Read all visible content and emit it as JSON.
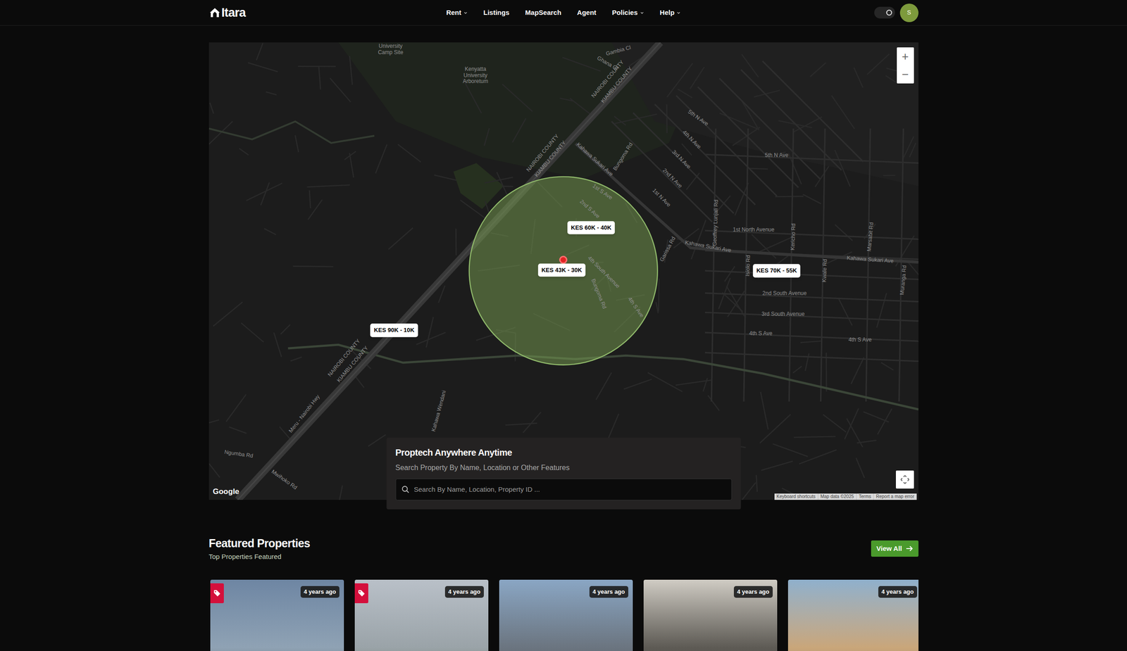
{
  "nav": {
    "logo": "Itara",
    "items": [
      {
        "label": "Rent",
        "kind": "dropdown"
      },
      {
        "label": "Listings",
        "kind": "link"
      },
      {
        "label": "MapSearch",
        "kind": "link"
      },
      {
        "label": "Agent",
        "kind": "link"
      },
      {
        "label": "Policies",
        "kind": "dropdown"
      },
      {
        "label": "Help",
        "kind": "dropdown"
      }
    ],
    "avatar": "S"
  },
  "map": {
    "labels": [
      "University",
      "Camp Site",
      "Kenyatta",
      "University",
      "Arboretum",
      "Gambia Cl",
      "Ghana Cl",
      "NAIROBI COUNTY",
      "KIAMBU COUNTY",
      "NAIROBI COUNTY",
      "KIAMBU COUNTY",
      "NAIROBI COUNTY",
      "KIAMBU COUNTY",
      "Kahawa Sukari Ave",
      "Bungoma Rd",
      "5th N Ave",
      "4th N Ave",
      "3rd N Ave",
      "2nd N Ave",
      "1st N Ave",
      "5th N Ave",
      "1st S Ave",
      "2nd S Ave",
      "4th South Avenue",
      "Bungoma Rd",
      "4th S Ave",
      "Garissa Rd",
      "Kahawa Sukari Ave",
      "Geoffrey Lunjali Rd",
      "1st North Avenue",
      "Kericho Rd",
      "Marsabit Rd",
      "Kahawa Sukari Ave",
      "Muranga Rd",
      "Isiolo Rd",
      "Kwale Rd",
      "2nd South Avenue",
      "3rd South Avenue",
      "4th S Ave",
      "4th S Ave",
      "Ngumba Rd",
      "Mwihoko Rd",
      "Meru - Nairobi Hwy",
      "Kahawa Wendani"
    ],
    "price_pins": [
      "KES 60K - 40K",
      "KES 43K - 30K",
      "KES 70K - 55K",
      "KES 90K - 10K"
    ],
    "zoom": [
      "+",
      "−"
    ],
    "google": "Google",
    "attribution": [
      "Keyboard shortcuts",
      "Map data ©2025",
      "Terms",
      "Report a map error"
    ]
  },
  "search": {
    "title": "Proptech Anywhere Anytime",
    "subtitle": "Search Property By Name, Location or Other Features",
    "placeholder": "Search By Name, Location, Property ID ..."
  },
  "featured": {
    "title": "Featured Properties",
    "subtitle": "Top Properties Featured",
    "view_all": "View All",
    "cards": [
      {
        "time": "4 years ago",
        "tagged": true
      },
      {
        "time": "4 years ago",
        "tagged": true
      },
      {
        "time": "4 years ago",
        "tagged": false
      },
      {
        "time": "4 years ago",
        "tagged": false
      },
      {
        "time": "4 years ago",
        "tagged": false
      }
    ]
  }
}
